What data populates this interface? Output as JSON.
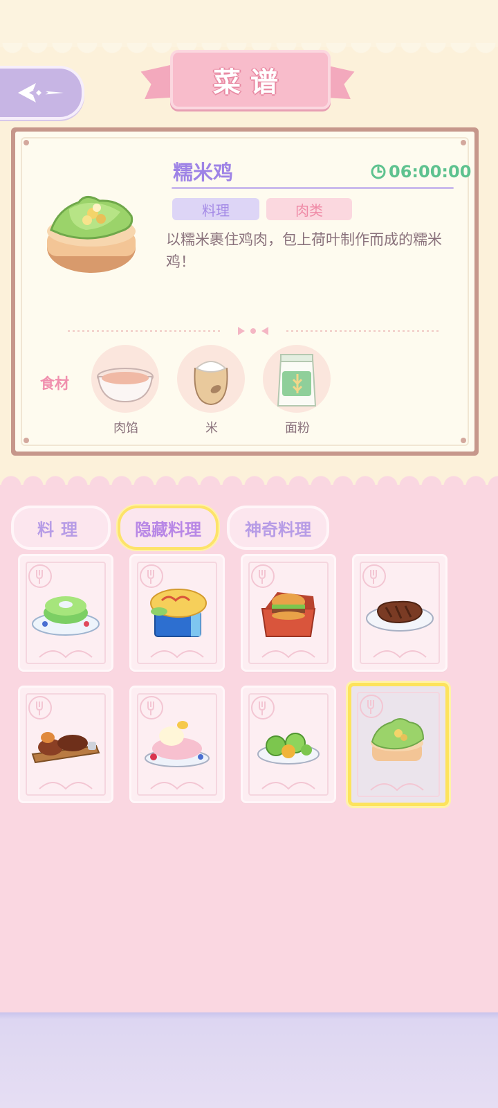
{
  "header": {
    "title": "菜谱"
  },
  "recipe": {
    "name": "糯米鸡",
    "time": "06:00:00",
    "tags": [
      "料理",
      "肉类"
    ],
    "description": "以糯米裹住鸡肉，包上荷叶制作而成的糯米鸡！",
    "ingredients_label": "食材",
    "ingredients": [
      {
        "name": "肉馅",
        "icon": "meat-filling-bowl-icon"
      },
      {
        "name": "米",
        "icon": "rice-sack-icon"
      },
      {
        "name": "面粉",
        "icon": "flour-bag-icon"
      }
    ]
  },
  "tabs": [
    {
      "label": "料理",
      "active": false
    },
    {
      "label": "隐藏料理",
      "active": true
    },
    {
      "label": "神奇料理",
      "active": false
    }
  ],
  "dishes": [
    {
      "icon": "green-pancake-icon",
      "selected": false
    },
    {
      "icon": "omelette-box-icon",
      "selected": false
    },
    {
      "icon": "burger-box-icon",
      "selected": false
    },
    {
      "icon": "steak-icon",
      "selected": false
    },
    {
      "icon": "grilled-meat-platter-icon",
      "selected": false
    },
    {
      "icon": "pig-cake-icon",
      "selected": false
    },
    {
      "icon": "green-buns-icon",
      "selected": false
    },
    {
      "icon": "lotus-leaf-chicken-icon",
      "selected": true
    }
  ],
  "colors": {
    "accent_purple": "#9e83e6",
    "timer_green": "#5ec28f",
    "tab_highlight": "#fde35c",
    "pink_bg": "#fad7e1",
    "cream_bg": "#fcf1da"
  }
}
